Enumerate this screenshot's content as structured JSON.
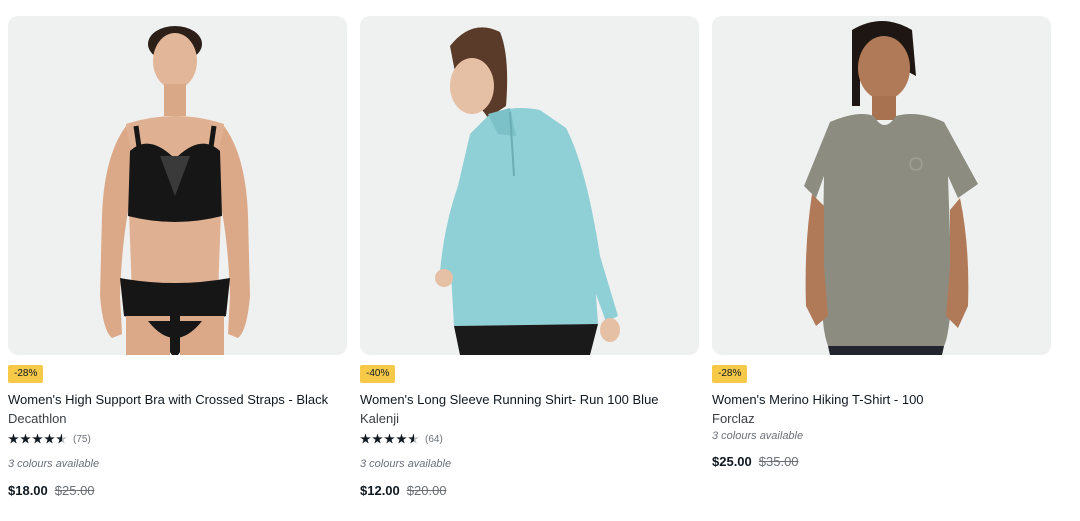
{
  "products": [
    {
      "badge": "-28%",
      "title": "Women's High Support Bra with Crossed Straps - Black",
      "brand": "Decathlon",
      "rating": 4.5,
      "review_count": "(75)",
      "colours": "3 colours available",
      "price": "$18.00",
      "old_price": "$25.00"
    },
    {
      "badge": "-40%",
      "title": "Women's Long Sleeve Running Shirt- Run 100 Blue",
      "brand": "Kalenji",
      "rating": 4.5,
      "review_count": "(64)",
      "colours": "3 colours available",
      "price": "$12.00",
      "old_price": "$20.00"
    },
    {
      "badge": "-28%",
      "title": "Women's Merino Hiking T-Shirt - 100",
      "brand": "Forclaz",
      "colours": "3 colours available",
      "price": "$25.00",
      "old_price": "$35.00"
    }
  ],
  "colors": {
    "badge": "#f7c948",
    "image_bg": "#eff0f0",
    "text": "#101820",
    "muted": "#6b7077"
  }
}
